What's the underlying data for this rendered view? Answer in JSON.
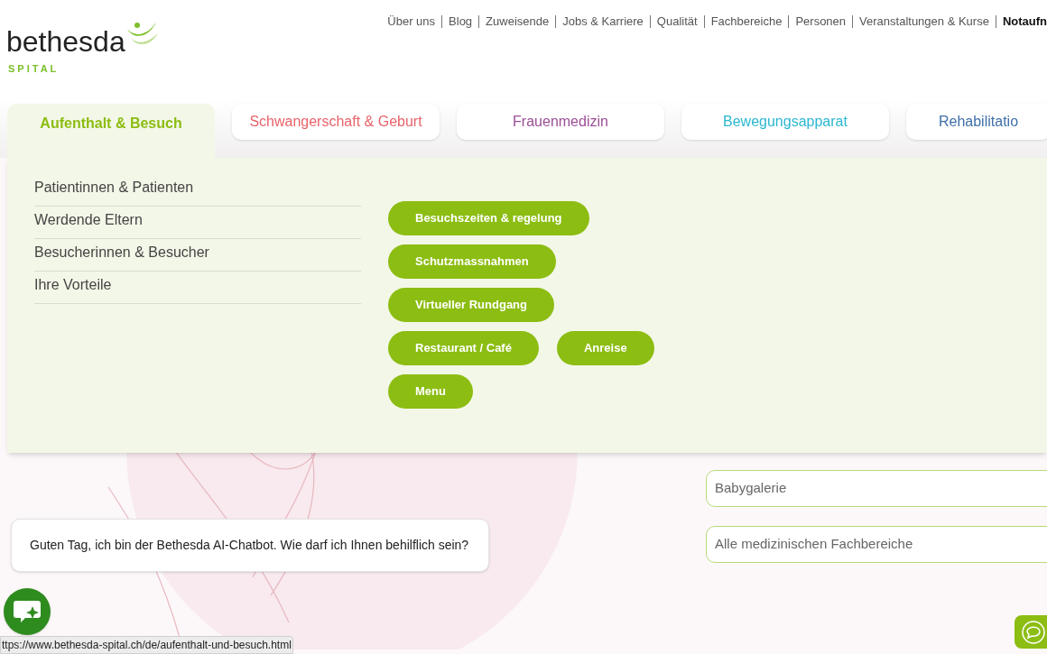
{
  "logo": {
    "name": "bethesda",
    "sub": "SPITAL"
  },
  "top_nav": [
    {
      "label": "Über uns",
      "bold": false
    },
    {
      "label": "Blog",
      "bold": false
    },
    {
      "label": "Zuweisende",
      "bold": false
    },
    {
      "label": "Jobs & Karriere",
      "bold": false
    },
    {
      "label": "Qualität",
      "bold": false
    },
    {
      "label": "Fachbereiche",
      "bold": false
    },
    {
      "label": "Personen",
      "bold": false
    },
    {
      "label": "Veranstaltungen & Kurse",
      "bold": false
    },
    {
      "label": "Notaufn",
      "bold": true
    }
  ],
  "tabs": [
    {
      "label": "Aufenthalt & Besuch",
      "selected": true,
      "color": "#8cbd12"
    },
    {
      "label": "Schwangerschaft & Geburt",
      "selected": false,
      "color": "#e8636b"
    },
    {
      "label": "Frauenmedizin",
      "selected": false,
      "color": "#9b4f96"
    },
    {
      "label": "Bewegungsapparat",
      "selected": false,
      "color": "#2bb8cf"
    },
    {
      "label": "Rehabilitatio",
      "selected": false,
      "color": "#3f6fa8"
    }
  ],
  "menu": [
    "Patientinnen & Patienten",
    "Werdende Eltern",
    "Besucherinnen & Besucher",
    "Ihre Vorteile"
  ],
  "pill_rows": [
    [
      "Besuchszeiten & regelung"
    ],
    [
      "Schutzmassnahmen"
    ],
    [
      "Virtueller Rundgang"
    ],
    [
      "Restaurant / Café",
      "Anreise"
    ],
    [
      "Menu"
    ]
  ],
  "fields": [
    {
      "value": "Babygalerie"
    },
    {
      "value": "Alle medizinischen Fachbereiche"
    }
  ],
  "chatbot": {
    "message": "Guten Tag, ich bin der Bethesda AI-Chatbot. Wie darf ich Ihnen behilflich sein?"
  },
  "status_bar": {
    "url": "ttps://www.bethesda-spital.ch/de/aufenthalt-und-besuch.html"
  }
}
